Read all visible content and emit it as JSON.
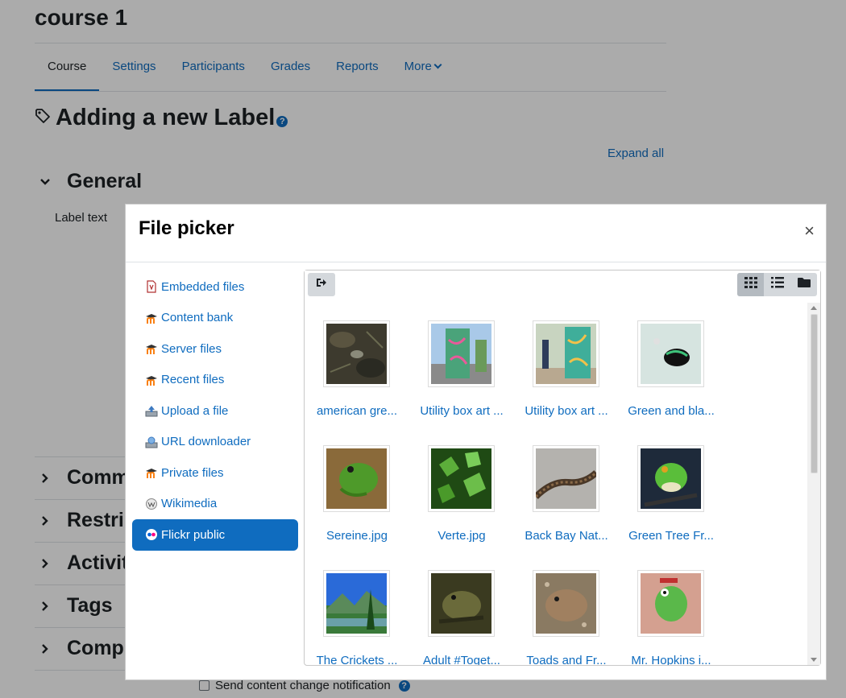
{
  "course": {
    "title": "course 1"
  },
  "secondary_nav": {
    "tabs": [
      {
        "label": "Course",
        "active": true
      },
      {
        "label": "Settings",
        "active": false
      },
      {
        "label": "Participants",
        "active": false
      },
      {
        "label": "Grades",
        "active": false
      },
      {
        "label": "Reports",
        "active": false
      },
      {
        "label": "More",
        "active": false
      }
    ]
  },
  "form": {
    "heading": "Adding a new Label",
    "expand_all": "Expand all",
    "sections": [
      {
        "label": "General",
        "expanded": true
      },
      {
        "label": "Comm",
        "expanded": false
      },
      {
        "label": "Restri",
        "expanded": false
      },
      {
        "label": "Activit",
        "expanded": false
      },
      {
        "label": "Tags",
        "expanded": false
      },
      {
        "label": "Comp",
        "expanded": false
      }
    ],
    "label_text": "Label text",
    "notify_label": "Send content change notification"
  },
  "file_picker": {
    "title": "File picker",
    "close_glyph": "×",
    "repositories": [
      {
        "label": "Embedded files",
        "icon": "embedded-files-icon",
        "active": false
      },
      {
        "label": "Content bank",
        "icon": "moodle-icon",
        "active": false
      },
      {
        "label": "Server files",
        "icon": "moodle-icon",
        "active": false
      },
      {
        "label": "Recent files",
        "icon": "moodle-icon",
        "active": false
      },
      {
        "label": "Upload a file",
        "icon": "upload-icon",
        "active": false
      },
      {
        "label": "URL downloader",
        "icon": "url-download-icon",
        "active": false
      },
      {
        "label": "Private files",
        "icon": "moodle-icon",
        "active": false
      },
      {
        "label": "Wikimedia",
        "icon": "wikimedia-icon",
        "active": false
      },
      {
        "label": "Flickr public",
        "icon": "flickr-icon",
        "active": true
      }
    ],
    "view_mode": "icons",
    "files": [
      {
        "name": "american gre..."
      },
      {
        "name": "Utility box art ..."
      },
      {
        "name": "Utility box art ..."
      },
      {
        "name": "Green and bla..."
      },
      {
        "name": "Sereine.jpg"
      },
      {
        "name": "Verte.jpg"
      },
      {
        "name": "Back Bay Nat..."
      },
      {
        "name": "Green Tree Fr..."
      },
      {
        "name": "The Crickets ..."
      },
      {
        "name": "Adult #Toget..."
      },
      {
        "name": "Toads and Fr..."
      },
      {
        "name": "Mr. Hopkins i..."
      }
    ]
  },
  "colors": {
    "accent": "#0f6cbf",
    "text": "#1d2125"
  }
}
